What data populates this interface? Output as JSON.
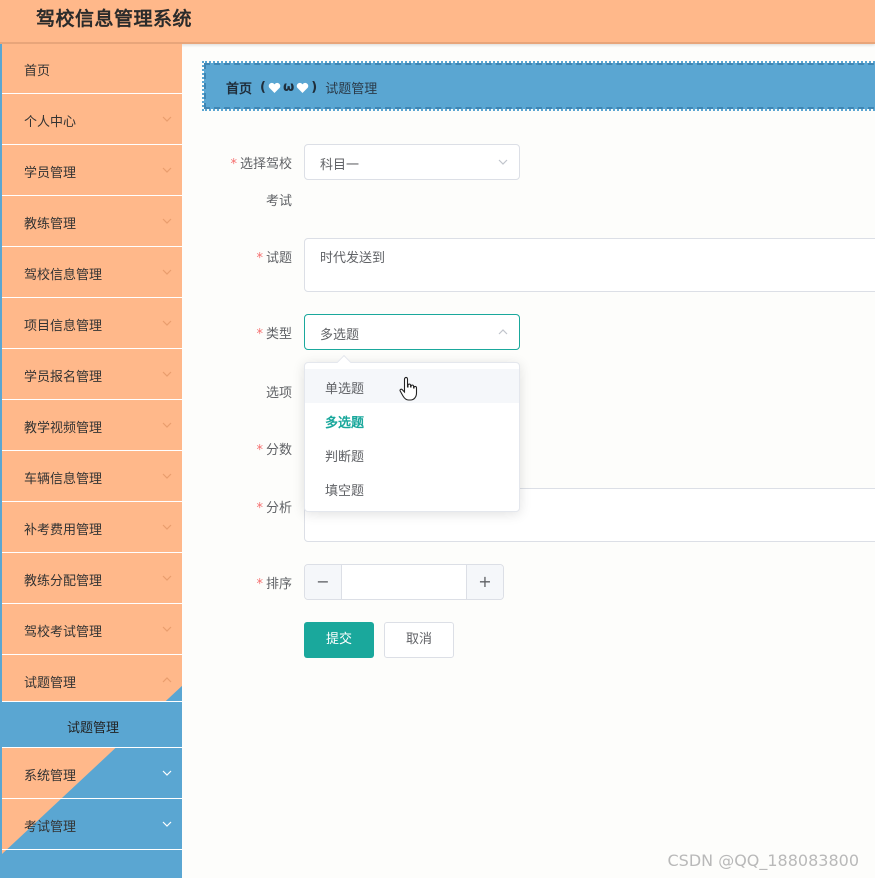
{
  "header": {
    "title": "驾校信息管理系统"
  },
  "sidebar": {
    "items": [
      {
        "label": "首页"
      },
      {
        "label": "个人中心"
      },
      {
        "label": "学员管理"
      },
      {
        "label": "教练管理"
      },
      {
        "label": "驾校信息管理"
      },
      {
        "label": "项目信息管理"
      },
      {
        "label": "学员报名管理"
      },
      {
        "label": "教学视频管理"
      },
      {
        "label": "车辆信息管理"
      },
      {
        "label": "补考费用管理"
      },
      {
        "label": "教练分配管理"
      },
      {
        "label": "驾校考试管理"
      },
      {
        "label": "试题管理"
      },
      {
        "label": "系统管理"
      },
      {
        "label": "考试管理"
      }
    ],
    "sub_item": {
      "label": "试题管理"
    }
  },
  "breadcrumb": {
    "home": "首页",
    "separator": "ω",
    "current": "试题管理"
  },
  "form": {
    "exam": {
      "label_line1": "选择驾校",
      "label_line2": "考试",
      "value": "科目一"
    },
    "question": {
      "label": "试题",
      "value": "时代发送到"
    },
    "type": {
      "label": "类型",
      "value": "多选题"
    },
    "options": {
      "label": "选项"
    },
    "score": {
      "label": "分数"
    },
    "analysis": {
      "label": "分析"
    },
    "sort": {
      "label": "排序",
      "minus": "−",
      "plus": "+"
    },
    "submit_label": "提交",
    "cancel_label": "取消"
  },
  "dropdown": {
    "options": [
      "单选题",
      "多选题",
      "判断题",
      "填空题"
    ],
    "selected": "多选题",
    "hovered": "单选题"
  },
  "watermark": "CSDN @QQ_188083800",
  "colors": {
    "header": "#ffb88a",
    "sidebar": "#ffb88a",
    "accent_blue": "#5aa6d2",
    "primary": "#1aa89c",
    "required": "#f56c6c"
  }
}
